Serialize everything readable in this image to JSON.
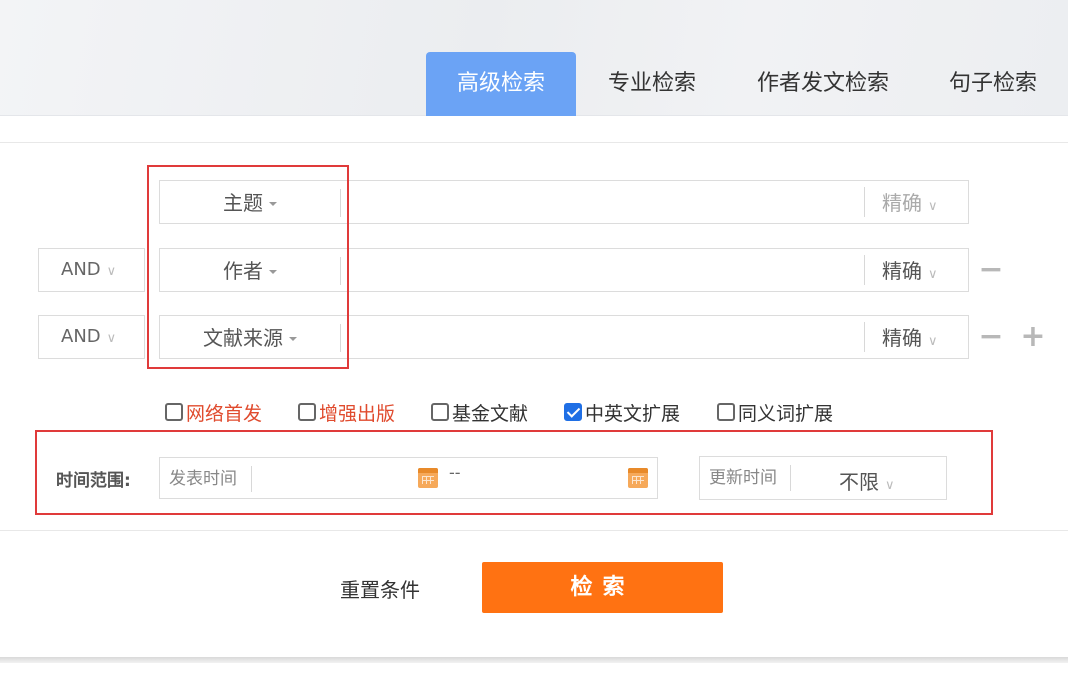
{
  "tabs": [
    {
      "label": "高级检索",
      "active": true
    },
    {
      "label": "专业检索",
      "active": false
    },
    {
      "label": "作者发文检索",
      "active": false
    },
    {
      "label": "句子检索",
      "active": false
    }
  ],
  "rows": [
    {
      "logic": null,
      "field": "主题",
      "value": "",
      "match": "精确",
      "match_is_placeholder": true
    },
    {
      "logic": "AND",
      "field": "作者",
      "value": "",
      "match": "精确",
      "match_is_placeholder": false
    },
    {
      "logic": "AND",
      "field": "文献来源",
      "value": "",
      "match": "精确",
      "match_is_placeholder": false
    }
  ],
  "row_controls": {
    "remove": "−",
    "add": "+"
  },
  "options": [
    {
      "label": "网络首发",
      "checked": false,
      "highlight": true
    },
    {
      "label": "增强出版",
      "checked": false,
      "highlight": true
    },
    {
      "label": "基金文献",
      "checked": false,
      "highlight": false
    },
    {
      "label": "中英文扩展",
      "checked": true,
      "highlight": false
    },
    {
      "label": "同义词扩展",
      "checked": false,
      "highlight": false
    }
  ],
  "time_range": {
    "label": "时间范围:",
    "publish_label": "发表时间",
    "separator": "--",
    "start_value": "",
    "end_value": "",
    "update_label": "更新时间",
    "update_value": "不限"
  },
  "actions": {
    "reset": "重置条件",
    "search": "检索"
  },
  "colors": {
    "tab_active": "#6ba3f5",
    "search_button": "#ff7212",
    "highlight_text": "#e04b2e",
    "annotation_border": "#e03a3a",
    "checkbox_checked": "#1f6fe5"
  },
  "icons": {
    "calendar": "calendar-icon",
    "dropdown": "chevron-down-icon"
  }
}
